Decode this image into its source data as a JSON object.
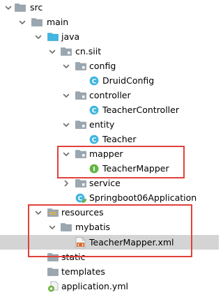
{
  "accent": "#e2403a",
  "tree": [
    {
      "label": "src",
      "icon": "folder-icon",
      "expanded": true
    },
    {
      "label": "main",
      "icon": "folder-icon",
      "expanded": true
    },
    {
      "label": "java",
      "icon": "source-folder-icon",
      "expanded": true
    },
    {
      "label": "cn.siit",
      "icon": "package-icon",
      "expanded": true
    },
    {
      "label": "config",
      "icon": "package-icon",
      "expanded": true
    },
    {
      "label": "DruidConfig",
      "icon": "class-icon"
    },
    {
      "label": "controller",
      "icon": "package-icon",
      "expanded": true
    },
    {
      "label": "TeacherController",
      "icon": "class-icon"
    },
    {
      "label": "entity",
      "icon": "package-icon",
      "expanded": true
    },
    {
      "label": "Teacher",
      "icon": "class-icon"
    },
    {
      "label": "mapper",
      "icon": "package-icon",
      "expanded": true
    },
    {
      "label": "TeacherMapper",
      "icon": "interface-icon"
    },
    {
      "label": "service",
      "icon": "package-icon",
      "expanded": false
    },
    {
      "label": "Springboot06Application",
      "icon": "spring-boot-class-icon"
    },
    {
      "label": "resources",
      "icon": "resources-folder-icon",
      "expanded": true
    },
    {
      "label": "mybatis",
      "icon": "folder-icon",
      "expanded": true
    },
    {
      "label": "TeacherMapper.xml",
      "icon": "xml-file-icon",
      "selected": true
    },
    {
      "label": "static",
      "icon": "folder-icon"
    },
    {
      "label": "templates",
      "icon": "folder-icon"
    },
    {
      "label": "application.yml",
      "icon": "yml-file-icon"
    }
  ]
}
